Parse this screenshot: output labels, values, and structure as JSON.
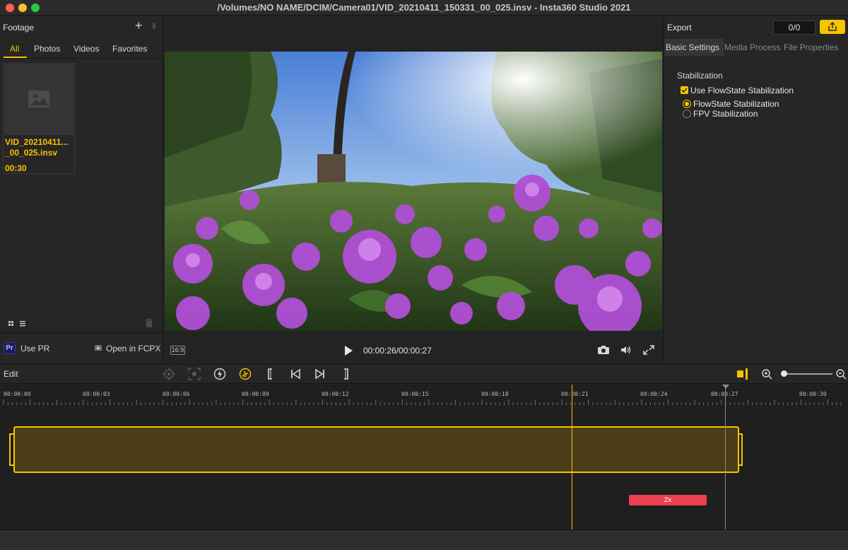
{
  "window": {
    "title": "/Volumes/NO NAME/DCIM/Camera01/VID_20210411_150331_00_025.insv - Insta360 Studio 2021"
  },
  "footage": {
    "title": "Footage",
    "add_label": "+",
    "tabs": [
      "All",
      "Photos",
      "Videos",
      "Favorites"
    ],
    "active_tab": "All",
    "items": [
      {
        "name_line1": "VID_20210411...",
        "name_line2": "_00_025.insv",
        "duration": "00:30"
      }
    ],
    "use_pr_label": "Use PR",
    "pr_logo_text": "Pr",
    "open_fcpx_label": "Open in FCPX"
  },
  "preview": {
    "aspect": "16:9",
    "timecode": "00:00:26/00:00:27"
  },
  "export": {
    "title": "Export",
    "count": "0/0",
    "tabs": [
      "Basic Settings",
      "Media Process",
      "File Properties"
    ],
    "active_tab": "Basic Settings",
    "stabilization_label": "Stabilization",
    "use_flowstate_label": "Use FlowState Stabilization",
    "use_flowstate_checked": true,
    "modes": [
      {
        "label": "FlowState Stabilization",
        "selected": true
      },
      {
        "label": "FPV Stabilization",
        "selected": false
      }
    ]
  },
  "edit": {
    "title": "Edit"
  },
  "timeline": {
    "ruler": [
      "00:00:00",
      "00:00:03",
      "00:00:06",
      "00:00:09",
      "00:00:12",
      "00:00:15",
      "00:00:18",
      "00:00:21",
      "00:00:24",
      "00:00:27",
      "00:00:30"
    ],
    "speed_tag": "2x"
  },
  "colors": {
    "accent": "#f6c300",
    "speed": "#ec3f52",
    "panel": "#262626",
    "timeline": "#1f1f1f"
  }
}
